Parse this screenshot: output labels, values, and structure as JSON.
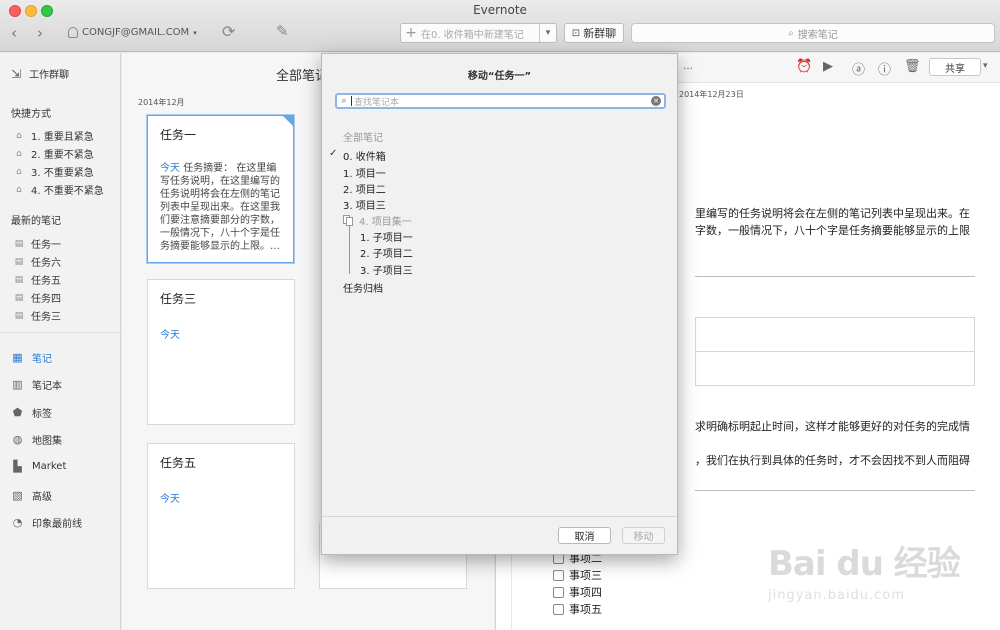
{
  "app_title": "Evernote",
  "toolbar": {
    "account": "CONGJF@GMAIL.COM",
    "new_note_placeholder": "在0. 收件箱中新建笔记",
    "new_chat_label": "新群聊",
    "search_placeholder": "搜索笔记"
  },
  "sidebar": {
    "work_chat": "工作群聊",
    "shortcuts_heading": "快捷方式",
    "shortcuts": [
      "1. 重要且紧急",
      "2. 重要不紧急",
      "3. 不重要紧急",
      "4. 不重要不紧急"
    ],
    "recent_heading": "最新的笔记",
    "recent": [
      "任务一",
      "任务六",
      "任务五",
      "任务四",
      "任务三"
    ],
    "nav": [
      {
        "label": "笔记",
        "icon": "notes-icon"
      },
      {
        "label": "笔记本",
        "icon": "notebook-icon"
      },
      {
        "label": "标签",
        "icon": "tag-icon"
      },
      {
        "label": "地图集",
        "icon": "atlas-icon"
      },
      {
        "label": "Market",
        "icon": "market-icon"
      },
      {
        "label": "高级",
        "icon": "premium-icon"
      },
      {
        "label": "印象最前线",
        "icon": "discover-icon"
      }
    ]
  },
  "notelist": {
    "title": "全部笔记",
    "date_group": "2014年12月",
    "cards": [
      {
        "title": "任务一",
        "date": "今天",
        "snippet": "任务摘要： 在这里编写任务说明，在这里编写的任务说明将会在左侧的笔记列表中呈现出来。在这里我们要注意摘要部分的字数，一般情况下，八十个字是任务摘要能够显示的上限。…"
      },
      {
        "title": "任务三",
        "date": "今天"
      },
      {
        "title": "任务五",
        "date": "今天"
      }
    ]
  },
  "editor": {
    "ellipsis": "…",
    "date": "2014年12月23日",
    "share_label": "共享",
    "lines": {
      "l1": "里编写的任务说明将会在左侧的笔记列表中呈现出来。在",
      "l2": "字数，一般情况下，八十个字是任务摘要能够显示的上限",
      "l3": "求明确标明起止时间，这样才能够更好的对任务的完成情",
      "l4": "，我们在执行到具体的任务时，才不会因找不到人而阻碍"
    },
    "checklist": [
      "事项二",
      "事项三",
      "事项四",
      "事项五"
    ]
  },
  "modal": {
    "title": "移动“任务一”",
    "search_placeholder": "查找笔记本",
    "all_notes_label": "全部笔记",
    "tree": [
      {
        "label": "0. 收件箱",
        "checked": true
      },
      {
        "label": "1. 项目一"
      },
      {
        "label": "2. 项目二"
      },
      {
        "label": "3. 项目三"
      },
      {
        "label": "4. 项目集一",
        "stack": true
      },
      {
        "label": "1. 子项目一"
      },
      {
        "label": "2. 子项目二"
      },
      {
        "label": "3. 子项目三"
      },
      {
        "label": "任务归档"
      }
    ],
    "cancel_label": "取消",
    "move_label": "移动"
  },
  "watermark": {
    "brand": "Bai du 经验",
    "url": "jingyan.baidu.com"
  },
  "colors": {
    "accent": "#2b7bd6",
    "selection": "#65a5e8"
  }
}
